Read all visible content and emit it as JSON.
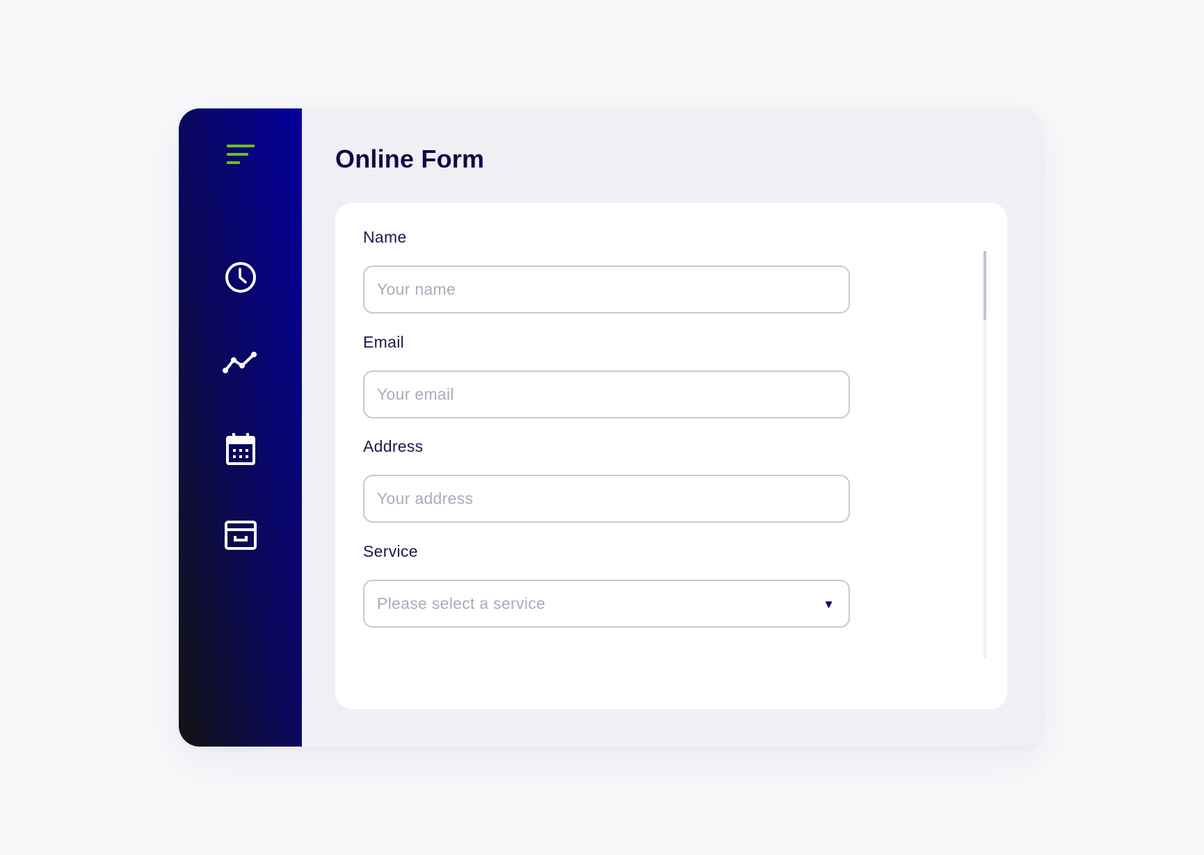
{
  "window": {
    "title": "Online Form"
  },
  "sidebar": {
    "items": [
      {
        "icon": "menu-icon",
        "color": "#6cc01c"
      },
      {
        "icon": "clock-icon"
      },
      {
        "icon": "trend-line-icon"
      },
      {
        "icon": "calendar-icon"
      },
      {
        "icon": "archive-box-icon"
      }
    ],
    "gradient": [
      "#131313",
      "#04009c"
    ]
  },
  "form": {
    "fields": [
      {
        "label": "Name",
        "placeholder": "Your name",
        "value": ""
      },
      {
        "label": "Email",
        "placeholder": "Your email",
        "value": ""
      },
      {
        "label": "Address",
        "placeholder": "Your address",
        "value": ""
      }
    ],
    "service": {
      "label": "Service",
      "placeholder": "Please select a service",
      "caret": "▼"
    }
  },
  "colors": {
    "accent": "#6cc01c",
    "title": "#0d0b45",
    "text": "#1b1a4c",
    "placeholder": "#a9acbd",
    "border": "#c6c8d2"
  }
}
